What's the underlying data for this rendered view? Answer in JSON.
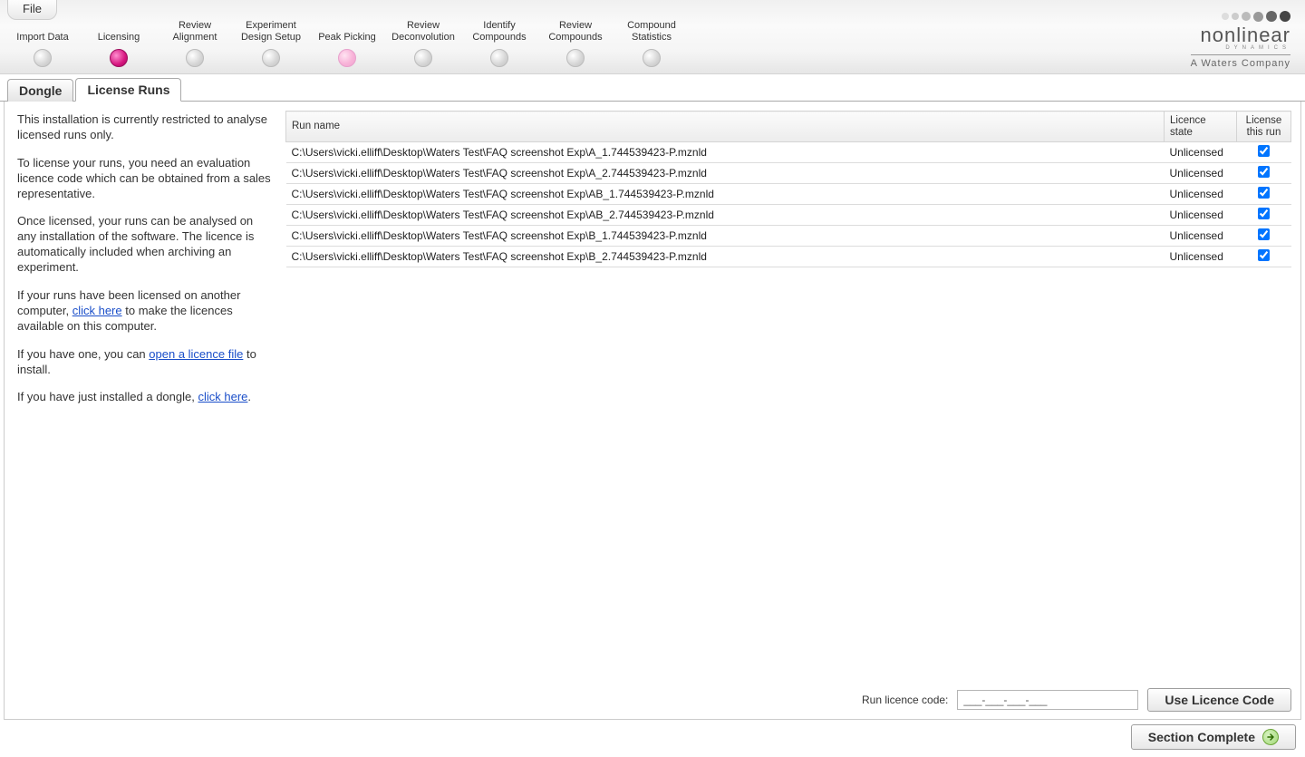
{
  "menu": {
    "file": "File"
  },
  "workflow": [
    {
      "label": "Import Data",
      "state": "normal"
    },
    {
      "label": "Licensing",
      "state": "active"
    },
    {
      "label": "Review Alignment",
      "state": "normal"
    },
    {
      "label": "Experiment Design Setup",
      "state": "normal"
    },
    {
      "label": "Peak Picking",
      "state": "pink"
    },
    {
      "label": "Review Deconvolution",
      "state": "normal"
    },
    {
      "label": "Identify Compounds",
      "state": "normal"
    },
    {
      "label": "Review Compounds",
      "state": "normal"
    },
    {
      "label": "Compound Statistics",
      "state": "normal"
    }
  ],
  "logo": {
    "brand": "nonlinear",
    "sub": "DYNAMICS",
    "tagline": "A Waters Company"
  },
  "tabs": [
    {
      "label": "Dongle",
      "active": false
    },
    {
      "label": "License Runs",
      "active": true
    }
  ],
  "sidebar": {
    "p1": "This installation is currently restricted to analyse licensed runs only.",
    "p2": "To license your runs, you need an evaluation licence code which can be obtained from a sales representative.",
    "p3": "Once licensed, your runs can be analysed on any installation of the software. The licence is automatically included when archiving an experiment.",
    "p4_a": "If your runs have been licensed on another computer, ",
    "p4_link": "click here",
    "p4_b": " to make the licences available on this computer.",
    "p5_a": "If you have one, you can ",
    "p5_link": "open a licence file",
    "p5_b": " to install.",
    "p6_a": "If you have just installed a dongle, ",
    "p6_link": "click here",
    "p6_b": "."
  },
  "table": {
    "columns": {
      "name": "Run name",
      "state": "Licence state",
      "license": "License this run"
    },
    "rows": [
      {
        "name": "C:\\Users\\vicki.elliff\\Desktop\\Waters Test\\FAQ screenshot Exp\\A_1.744539423-P.mznld",
        "state": "Unlicensed",
        "checked": true
      },
      {
        "name": "C:\\Users\\vicki.elliff\\Desktop\\Waters Test\\FAQ screenshot Exp\\A_2.744539423-P.mznld",
        "state": "Unlicensed",
        "checked": true
      },
      {
        "name": "C:\\Users\\vicki.elliff\\Desktop\\Waters Test\\FAQ screenshot Exp\\AB_1.744539423-P.mznld",
        "state": "Unlicensed",
        "checked": true
      },
      {
        "name": "C:\\Users\\vicki.elliff\\Desktop\\Waters Test\\FAQ screenshot Exp\\AB_2.744539423-P.mznld",
        "state": "Unlicensed",
        "checked": true
      },
      {
        "name": "C:\\Users\\vicki.elliff\\Desktop\\Waters Test\\FAQ screenshot Exp\\B_1.744539423-P.mznld",
        "state": "Unlicensed",
        "checked": true
      },
      {
        "name": "C:\\Users\\vicki.elliff\\Desktop\\Waters Test\\FAQ screenshot Exp\\B_2.744539423-P.mznld",
        "state": "Unlicensed",
        "checked": true
      }
    ]
  },
  "footer": {
    "code_label": "Run licence code:",
    "code_placeholder": "___-___-___-___",
    "use_button": "Use Licence Code",
    "section_complete": "Section Complete"
  }
}
